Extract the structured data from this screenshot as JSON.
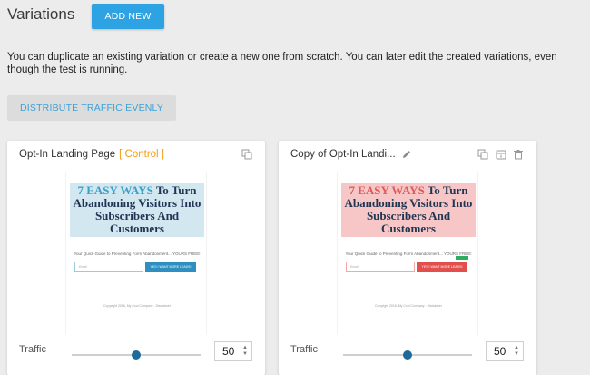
{
  "header": {
    "title": "Variations",
    "add_new_label": "ADD NEW"
  },
  "intro_text": "You can duplicate an existing variation or create a new one from scratch. You can later edit the created variations, even though the test is running.",
  "distribute_label": "DISTRIBUTE TRAFFIC EVENLY",
  "colors": {
    "primary": "#2ea3e3",
    "control_tag": "#f39c12",
    "slider_thumb": "#1e6a98"
  },
  "variations": [
    {
      "title": "Opt-In Landing Page",
      "tag": "[ Control ]",
      "icons": [
        "duplicate-icon"
      ],
      "preview": {
        "headline_accent": "7 EASY WAYS",
        "headline_rest": " To Turn Abandoning Visitors Into Subscribers And Customers",
        "subtitle": "Your Quick Guide to Preventing Form Abandonment... YOURS FREE!",
        "input_placeholder": "Email",
        "cta": "YES I WANT MORE LEADS!",
        "footer": "Copyright 2016, My Cool Company - Disclaimer"
      },
      "traffic_label": "Traffic",
      "traffic_value": "50"
    },
    {
      "title": "Copy of Opt-In Landi...",
      "tag": "",
      "icons": [
        "edit-icon",
        "duplicate-icon",
        "archive-icon",
        "trash-icon"
      ],
      "preview": {
        "headline_accent": "7 EASY WAYS",
        "headline_rest": " To Turn Abandoning Visitors Into Subscribers And Customers",
        "subtitle": "Your Quick Guide to Preventing Form Abandonment... YOURS FREE!",
        "input_placeholder": "Email",
        "cta": "YES I WANT MORE LEADS!",
        "footer": "Copyright 2016, My Cool Company - Disclaimer"
      },
      "traffic_label": "Traffic",
      "traffic_value": "50"
    }
  ]
}
